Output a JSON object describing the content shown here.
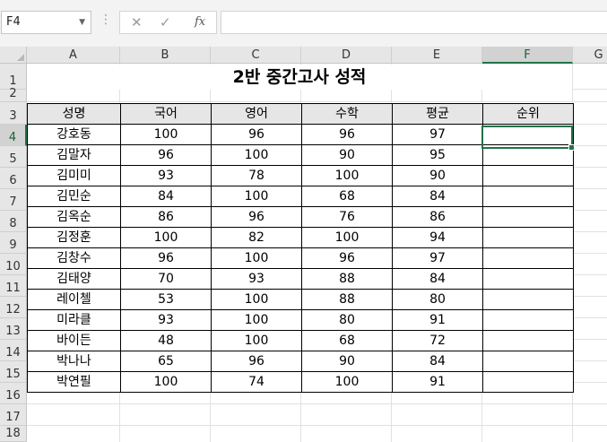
{
  "name_box": "F4",
  "formula_bar": {
    "cancel_icon": "close-icon",
    "enter_icon": "check-icon",
    "fx_label": "fx",
    "content": ""
  },
  "columns": [
    "A",
    "B",
    "C",
    "D",
    "E",
    "F",
    "G"
  ],
  "rows": [
    "1",
    "2",
    "3",
    "4",
    "5",
    "6",
    "7",
    "8",
    "9",
    "10",
    "11",
    "12",
    "13",
    "14",
    "15",
    "16",
    "17",
    "18"
  ],
  "title": "2반 중간고사 성적",
  "table": {
    "headers": [
      "성명",
      "국어",
      "영어",
      "수학",
      "평균",
      "순위"
    ],
    "rows": [
      [
        "강호동",
        "100",
        "96",
        "96",
        "97",
        ""
      ],
      [
        "김말자",
        "96",
        "100",
        "90",
        "95",
        ""
      ],
      [
        "김미미",
        "93",
        "78",
        "100",
        "90",
        ""
      ],
      [
        "김민순",
        "84",
        "100",
        "68",
        "84",
        ""
      ],
      [
        "김옥순",
        "86",
        "96",
        "76",
        "86",
        ""
      ],
      [
        "김정훈",
        "100",
        "82",
        "100",
        "94",
        ""
      ],
      [
        "김창수",
        "96",
        "100",
        "96",
        "97",
        ""
      ],
      [
        "김태양",
        "70",
        "93",
        "88",
        "84",
        ""
      ],
      [
        "레이첼",
        "53",
        "100",
        "88",
        "80",
        ""
      ],
      [
        "미라클",
        "93",
        "100",
        "80",
        "91",
        ""
      ],
      [
        "바이든",
        "48",
        "100",
        "68",
        "72",
        ""
      ],
      [
        "박나나",
        "65",
        "96",
        "90",
        "84",
        ""
      ],
      [
        "박연필",
        "100",
        "74",
        "100",
        "91",
        ""
      ]
    ]
  },
  "selected_cell": "F4",
  "accent_color": "#217346"
}
